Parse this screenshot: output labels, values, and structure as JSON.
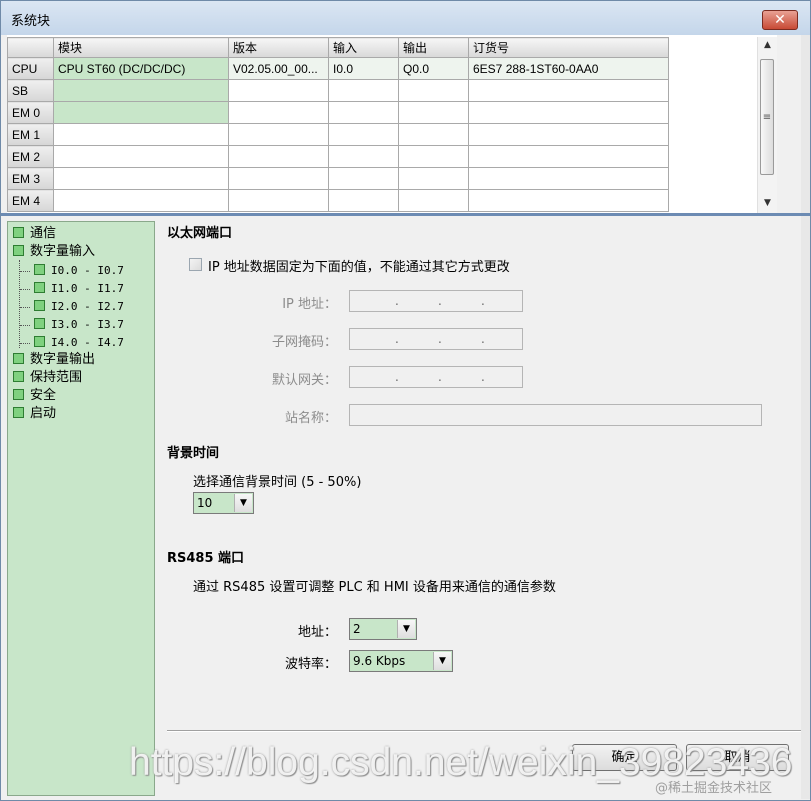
{
  "window": {
    "title": "系统块"
  },
  "module_table": {
    "headers": [
      "",
      "模块",
      "版本",
      "输入",
      "输出",
      "订货号"
    ],
    "rows": [
      {
        "slot": "CPU",
        "module": "CPU ST60 (DC/DC/DC)",
        "version": "V02.05.00_00...",
        "input": "I0.0",
        "output": "Q0.0",
        "order": "6ES7 288-1ST60-0AA0"
      },
      {
        "slot": "SB",
        "module": "",
        "version": "",
        "input": "",
        "output": "",
        "order": ""
      },
      {
        "slot": "EM 0",
        "module": "",
        "version": "",
        "input": "",
        "output": "",
        "order": ""
      },
      {
        "slot": "EM 1",
        "module": "",
        "version": "",
        "input": "",
        "output": "",
        "order": ""
      },
      {
        "slot": "EM 2",
        "module": "",
        "version": "",
        "input": "",
        "output": "",
        "order": ""
      },
      {
        "slot": "EM 3",
        "module": "",
        "version": "",
        "input": "",
        "output": "",
        "order": ""
      },
      {
        "slot": "EM 4",
        "module": "",
        "version": "",
        "input": "",
        "output": "",
        "order": ""
      }
    ]
  },
  "tree": {
    "communication": "通信",
    "digital_input": "数字量输入",
    "di_ranges": [
      "I0.0 - I0.7",
      "I1.0 - I1.7",
      "I2.0 - I2.7",
      "I3.0 - I3.7",
      "I4.0 - I4.7"
    ],
    "digital_output": "数字量输出",
    "retentive": "保持范围",
    "security": "安全",
    "startup": "启动"
  },
  "ethernet": {
    "heading": "以太网端口",
    "fixed_ip_label": "IP 地址数据固定为下面的值，不能通过其它方式更改",
    "ip_label": "IP 地址：",
    "subnet_label": "子网掩码：",
    "gateway_label": "默认网关：",
    "station_label": "站名称："
  },
  "background": {
    "heading": "背景时间",
    "label": "选择通信背景时间 (5 - 50%)",
    "value": "10"
  },
  "rs485": {
    "heading": "RS485 端口",
    "description": "通过 RS485 设置可调整 PLC 和 HMI 设备用来通信的通信参数",
    "address_label": "地址：",
    "address_value": "2",
    "baud_label": "波特率：",
    "baud_value": "9.6 Kbps"
  },
  "buttons": {
    "ok": "确定",
    "cancel": "取消"
  },
  "watermark": {
    "url": "https://blog.csdn.net/weixin_39823436",
    "site": "@稀土掘金技术社区"
  }
}
